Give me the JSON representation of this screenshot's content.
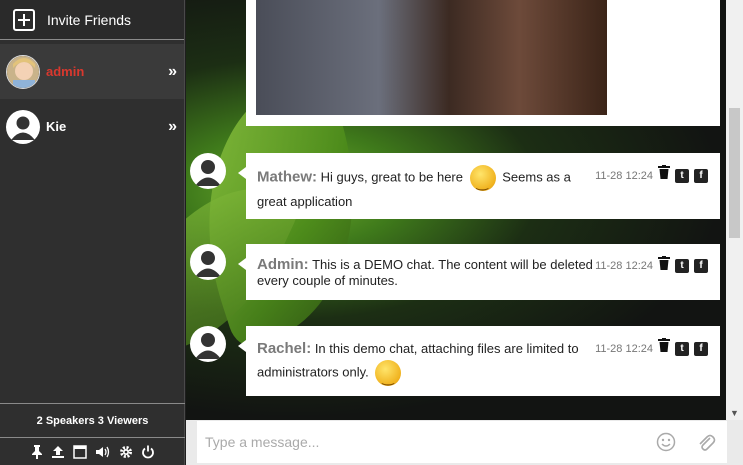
{
  "sidebar": {
    "invite_label": "Invite Friends",
    "users": [
      {
        "name": "admin",
        "color": "#d9382e"
      },
      {
        "name": "Kie",
        "color": "#ffffff"
      }
    ],
    "expand_glyph": "»",
    "stats": "2 Speakers 3 Viewers",
    "toolbar_icons": [
      "pin-icon",
      "upload-icon",
      "window-icon",
      "volume-icon",
      "gear-icon",
      "power-icon"
    ]
  },
  "messages": [
    {
      "author": "Mathew:",
      "text_a": "Hi guys, great to be here",
      "text_b": "Seems as a great application",
      "time": "11-28 12:24"
    },
    {
      "author": "Admin:",
      "text_a": "This is a DEMO chat. The content will be deleted every couple of minutes.",
      "time": "11-28 12:24"
    },
    {
      "author": "Rachel:",
      "text_a": "In this demo chat, attaching files are limited to administrators only.",
      "time": "11-28 12:24"
    }
  ],
  "composer": {
    "placeholder": "Type a message..."
  },
  "colors": {
    "accent_name": "#d9382e",
    "sidebar_bg": "#2f2f2f"
  }
}
